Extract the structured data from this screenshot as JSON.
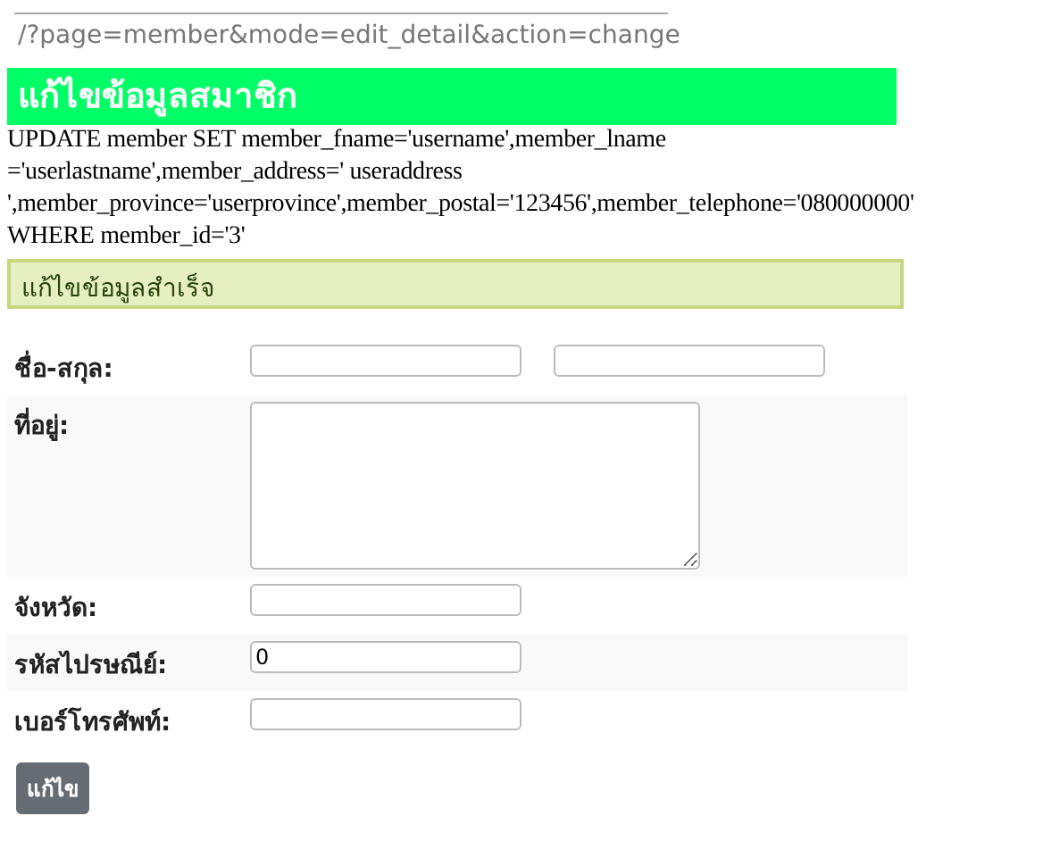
{
  "url": "/?page=member&mode=edit_detail&action=change",
  "title": "แก้ไขข้อมูลสมาชิก",
  "sql_lines": [
    "UPDATE member SET member_fname='username',member_lname",
    "='userlastname',member_address=' useraddress",
    "',member_province='userprovince',member_postal='123456',member_telephone='080000000'",
    "WHERE member_id='3'"
  ],
  "alert": "แก้ไขข้อมูลสำเร็จ",
  "form_rows": [
    {
      "label": "ชื่อ-สกุล:",
      "kind": "double"
    },
    {
      "label": "ที่อยู่:",
      "kind": "textarea"
    },
    {
      "label": "จังหวัด:",
      "kind": "single"
    },
    {
      "label": "รหัสไปรษณีย์:",
      "kind": "single",
      "value": "0"
    },
    {
      "label": "เบอร์โทรศัพท์:",
      "kind": "single"
    }
  ],
  "submit": "แก้ไข"
}
